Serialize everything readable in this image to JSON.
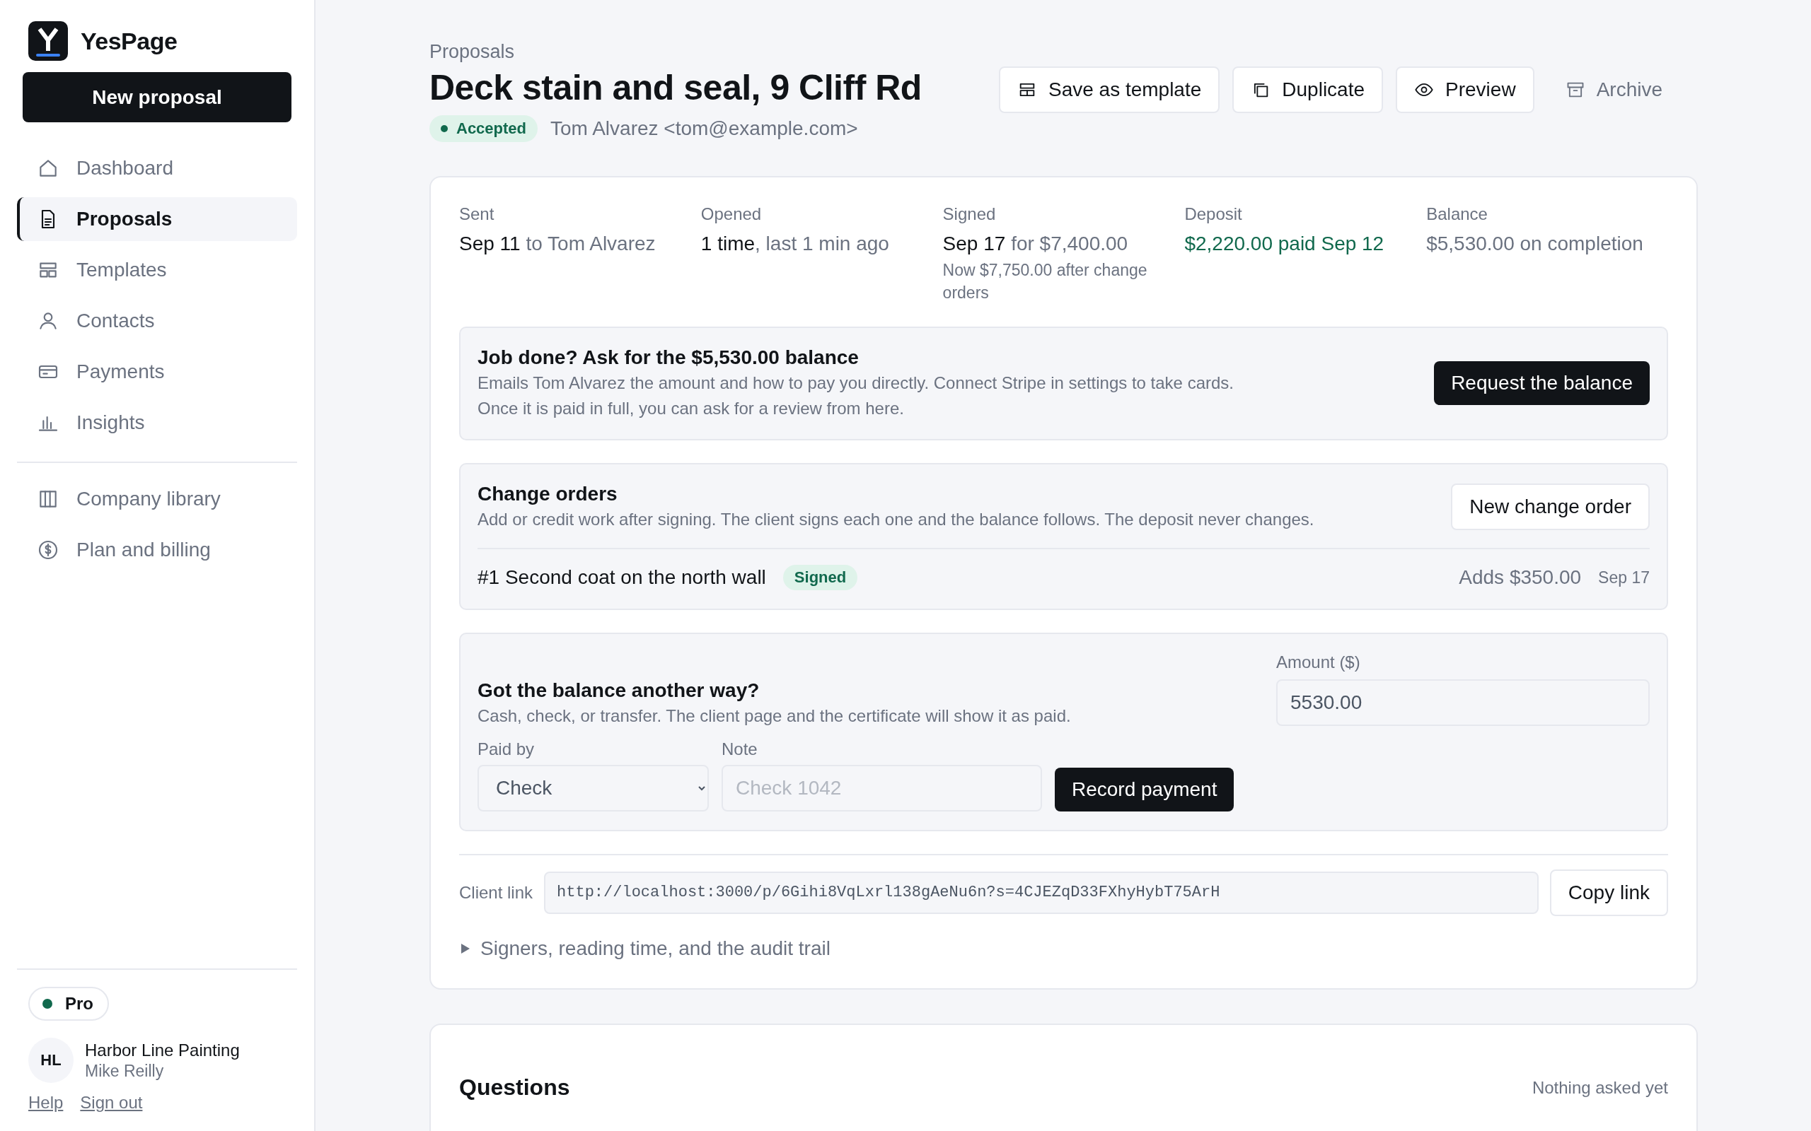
{
  "sidebar": {
    "brand": "YesPage",
    "new_button": "New proposal",
    "nav": [
      {
        "label": "Dashboard",
        "selected": false
      },
      {
        "label": "Proposals",
        "selected": true
      },
      {
        "label": "Templates",
        "selected": false
      },
      {
        "label": "Contacts",
        "selected": false
      },
      {
        "label": "Payments",
        "selected": false
      },
      {
        "label": "Insights",
        "selected": false
      }
    ],
    "nav_secondary": [
      {
        "label": "Company library",
        "selected": false
      },
      {
        "label": "Plan and billing",
        "selected": false
      }
    ],
    "plan": "Pro",
    "account": {
      "initials": "HL",
      "company": "Harbor Line Painting",
      "person": "Mike Reilly"
    },
    "links": [
      "Help",
      "Sign out"
    ]
  },
  "header": {
    "breadcrumb": "Proposals",
    "title": "Deck stain and seal, 9 Cliff Rd",
    "status": "Accepted",
    "client": "Tom Alvarez <tom@example.com>",
    "actions": [
      {
        "label": "Save as template",
        "kind": "outlined"
      },
      {
        "label": "Duplicate",
        "kind": "outlined"
      },
      {
        "label": "Preview",
        "kind": "outlined"
      },
      {
        "label": "Archive",
        "kind": "ghost"
      }
    ]
  },
  "summary": [
    {
      "label": "Sent",
      "value": "Sep 11",
      "detail": "to Tom Alvarez",
      "kind": "plain"
    },
    {
      "label": "Opened",
      "value": "1 time",
      "detail": ", last 1 min ago",
      "kind": "plain"
    },
    {
      "label": "Signed",
      "value": "Sep 17",
      "detail": "for $7,400.00",
      "note": "Now $7,750.00 after change orders",
      "kind": "plain"
    },
    {
      "label": "Deposit",
      "value": "$2,220.00 paid Sep 12",
      "kind": "paid"
    },
    {
      "label": "Balance",
      "detail": "$5,530.00 on completion",
      "kind": "plain"
    }
  ],
  "balance_request": {
    "title": "Job done? Ask for the $5,530.00 balance",
    "text": [
      "Emails Tom Alvarez the amount and how to pay you directly. Connect Stripe in settings to take cards.",
      "Once it is paid in full, you can ask for a review from here."
    ],
    "button": "Request the balance"
  },
  "change_orders": {
    "title": "Change orders",
    "description": "Add or credit work after signing. The client signs each one and the balance follows. The deposit never changes.",
    "button": "New change order",
    "items": [
      {
        "title": "#1 Second coat on the north wall",
        "status": "Signed",
        "amount": "Adds $350.00",
        "date": "Sep 17"
      }
    ]
  },
  "manual_payment": {
    "title": "Got the balance another way?",
    "description": "Cash, check, or transfer. The client page and the certificate will show it as paid.",
    "paid_by": {
      "label": "Paid by",
      "value": "Check"
    },
    "note": {
      "label": "Note",
      "placeholder": "Check 1042"
    },
    "button": "Record payment",
    "amount": {
      "label": "Amount ($)",
      "value": "5530.00"
    }
  },
  "client_link": {
    "label": "Client link",
    "value": "http://localhost:3000/p/6Gihi8VqLxrl138gAeNu6n?s=4CJEZqD33FXhyHybT75ArH",
    "button": "Copy link"
  },
  "details": {
    "label": "Signers, reading time, and the audit trail",
    "expanded": false
  },
  "questions": {
    "title": "Questions",
    "status": "Nothing asked yet"
  }
}
